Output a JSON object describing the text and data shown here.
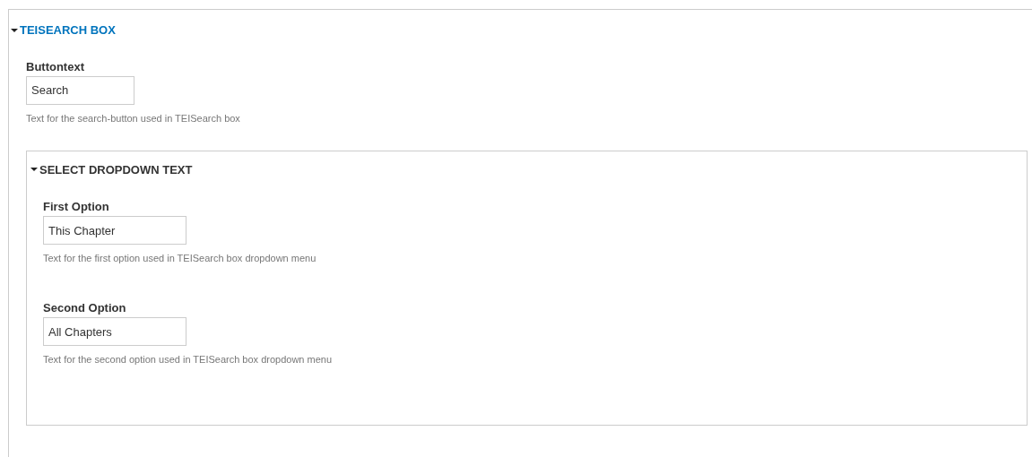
{
  "fieldset": {
    "legend": "TEISEARCH BOX",
    "expanded": true,
    "fields": [
      {
        "label": "Buttontext",
        "value": "Search",
        "description": "Text for the search-button used in TEISearch box"
      }
    ],
    "subfieldset": {
      "legend": "SELECT DROPDOWN TEXT",
      "expanded": true,
      "fields": [
        {
          "label": "First Option",
          "value": "This Chapter",
          "description": "Text for the first option used in TEISearch box dropdown menu"
        },
        {
          "label": "Second Option",
          "value": "All Chapters",
          "description": "Text for the second option used in TEISearch box dropdown menu"
        }
      ]
    }
  }
}
